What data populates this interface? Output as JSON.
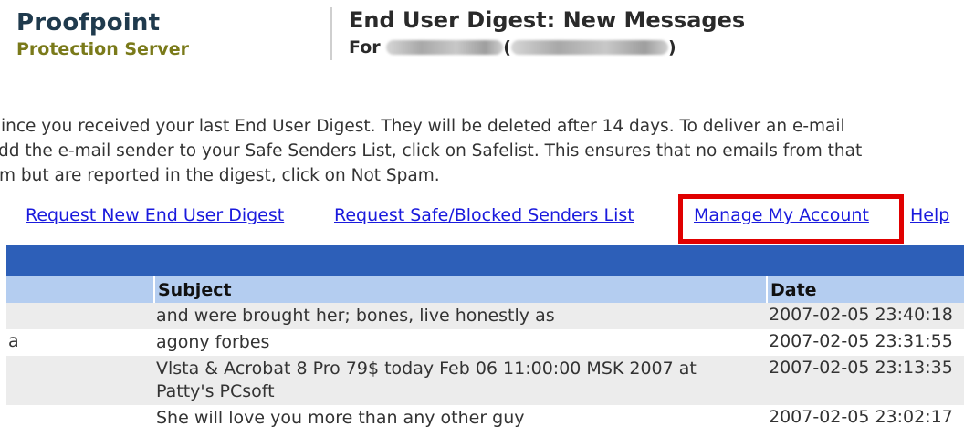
{
  "header": {
    "brand": "Proofpoint",
    "product": "Protection Server",
    "digest_title": "End User Digest: New Messages",
    "for_label": "For"
  },
  "intro": {
    "line1": "ince you received your last End User Digest. They will be deleted after 14 days. To deliver an e-mail",
    "line2": "dd the e-mail sender to your Safe Senders List, click on Safelist. This ensures that no emails from that",
    "line3": "m but are reported in the digest, click on Not Spam."
  },
  "links": {
    "request_digest": "Request New End User Digest",
    "request_senders": "Request Safe/Blocked Senders List",
    "manage_account": "Manage My Account",
    "help": "Help"
  },
  "table": {
    "columns": {
      "subject": "Subject",
      "date": "Date"
    },
    "rows": [
      {
        "from": "",
        "subject": "and were brought her; bones, live honestly as",
        "date": "2007-02-05 23:40:18"
      },
      {
        "from": "a",
        "subject": "agony forbes",
        "date": "2007-02-05 23:31:55"
      },
      {
        "from": "",
        "subject": "Vlsta & Acrobat 8 Pro 79$ today Feb 06 11:00:00 MSK 2007 at Patty's PCsoft",
        "date": "2007-02-05 23:13:35"
      },
      {
        "from": "",
        "subject": "She will love you more than any other guy",
        "date": "2007-02-05 23:02:17"
      }
    ]
  },
  "colors": {
    "brand": "#1f3a4d",
    "product": "#7a7a1a",
    "link": "#1a1add",
    "highlight": "#e00000",
    "header_bar": "#2d5fb8",
    "column_header": "#b4cdf0"
  }
}
